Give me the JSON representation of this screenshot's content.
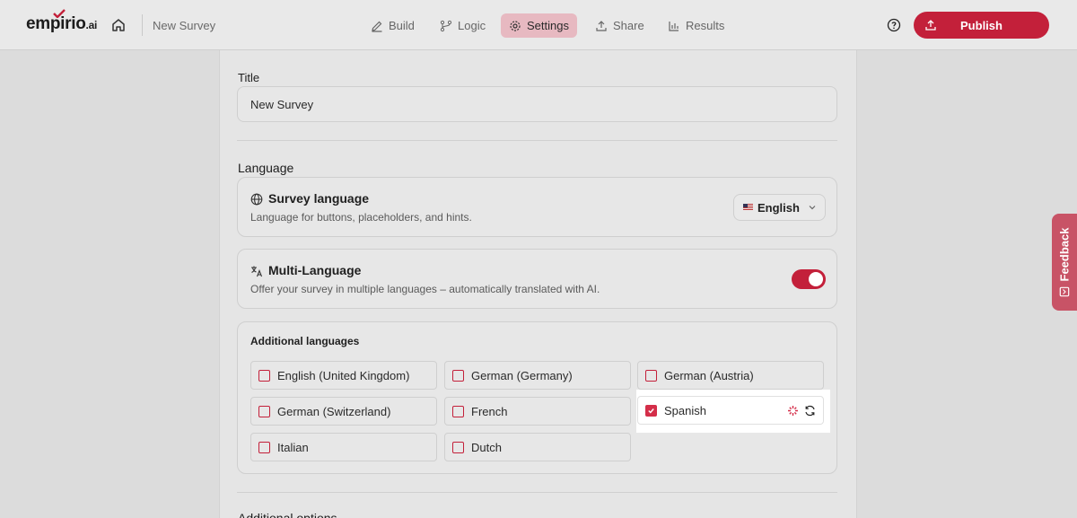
{
  "header": {
    "logo": "empirio",
    "logo_suffix": ".ai",
    "survey_name": "New Survey",
    "nav": [
      {
        "label": "Build",
        "icon": "pencil-icon"
      },
      {
        "label": "Logic",
        "icon": "branch-icon"
      },
      {
        "label": "Settings",
        "icon": "gear-icon",
        "active": true
      },
      {
        "label": "Share",
        "icon": "upload-icon"
      },
      {
        "label": "Results",
        "icon": "bar-chart-icon"
      }
    ],
    "publish_label": "Publish"
  },
  "settings": {
    "title_label": "Title",
    "title_value": "New Survey",
    "language_heading": "Language",
    "survey_language": {
      "title": "Survey language",
      "description": "Language for buttons, placeholders, and hints.",
      "selected": "English"
    },
    "multi_language": {
      "title": "Multi-Language",
      "description": "Offer your survey in multiple languages – automatically translated with AI.",
      "enabled": true
    },
    "additional_languages": {
      "title": "Additional languages",
      "options": [
        {
          "label": "English (United Kingdom)",
          "checked": false
        },
        {
          "label": "German (Germany)",
          "checked": false
        },
        {
          "label": "German (Austria)",
          "checked": false
        },
        {
          "label": "German (Switzerland)",
          "checked": false
        },
        {
          "label": "French",
          "checked": false
        },
        {
          "label": "Spanish",
          "checked": true
        },
        {
          "label": "Italian",
          "checked": false
        },
        {
          "label": "Dutch",
          "checked": false
        }
      ]
    },
    "next_section_heading": "Additional options"
  },
  "feedback_label": "Feedback",
  "colors": {
    "accent": "#c3203a",
    "highlight": "#ffffff"
  }
}
